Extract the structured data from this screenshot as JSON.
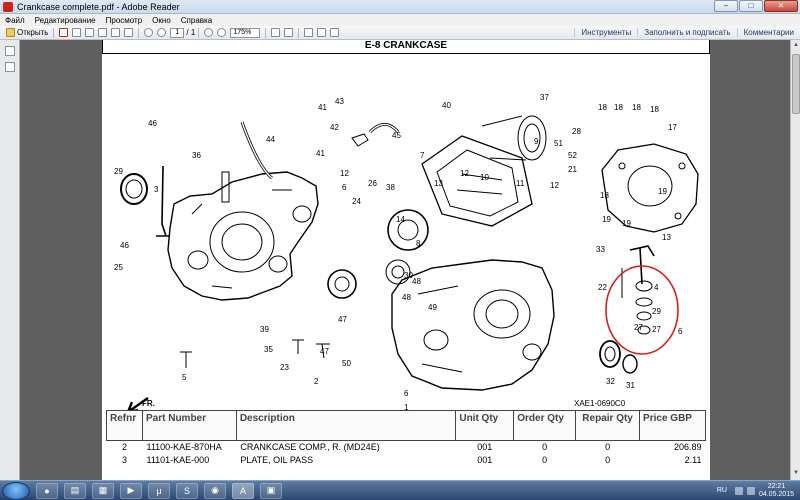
{
  "window": {
    "title": "Crankcase complete.pdf - Adobe Reader",
    "min_label": "–",
    "max_label": "□",
    "close_label": "✕"
  },
  "menu": [
    "Файл",
    "Редактирование",
    "Просмотр",
    "Окно",
    "Справка"
  ],
  "toolbar": {
    "open_label": "Открыть",
    "page_current": "1",
    "page_total": "/ 1",
    "zoom": "175%",
    "tools_label": "Инструменты",
    "fill_sign_label": "Заполнить и подписать",
    "comments_label": "Комментарии"
  },
  "document": {
    "section_title": "E-8 CRANKCASE",
    "fr_label": "FR.",
    "diagram_code": "XAE1-0690C0",
    "part_labels": [
      "46",
      "41",
      "44",
      "43",
      "42",
      "45",
      "36",
      "41",
      "7",
      "12",
      "6",
      "40",
      "37",
      "18",
      "18",
      "18",
      "18",
      "17",
      "29",
      "3",
      "46",
      "26",
      "25",
      "38",
      "24",
      "14",
      "13",
      "12",
      "10",
      "9",
      "11",
      "51",
      "28",
      "8",
      "18",
      "19",
      "19",
      "19",
      "13",
      "33",
      "22",
      "4",
      "29",
      "27",
      "27",
      "6",
      "32",
      "31",
      "30",
      "48",
      "48",
      "49",
      "47",
      "39",
      "35",
      "47",
      "50",
      "2",
      "23",
      "5",
      "6",
      "1",
      "51",
      "52",
      "21",
      "12"
    ]
  },
  "table": {
    "headers": [
      "Refnr",
      "Part Number",
      "Description",
      "Unit Qty",
      "Order Qty",
      "Repair Qty",
      "Price GBP"
    ],
    "rows": [
      [
        "2",
        "11100-KAE-870HA",
        "CRANKCASE COMP., R. (MD24E)",
        "001",
        "0",
        "0",
        "206.89"
      ],
      [
        "3",
        "11101-KAE-000",
        "PLATE, OIL PASS",
        "001",
        "0",
        "0",
        "2.11"
      ]
    ]
  },
  "taskbar": {
    "lang": "RU",
    "time": "22:21",
    "date": "04.05.2015"
  }
}
